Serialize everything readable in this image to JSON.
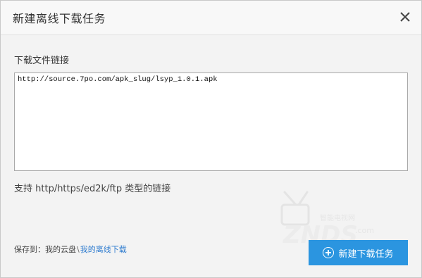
{
  "dialog": {
    "title": "新建离线下载任务",
    "close_icon": "close-icon"
  },
  "form": {
    "url_label": "下载文件链接",
    "url_value": "http://source.7po.com/apk_slug/lsyp_1.0.1.apk",
    "hint": "支持 http/https/ed2k/ftp 类型的链接"
  },
  "save": {
    "label": "保存到：",
    "path_root": "我的云盘",
    "separator": "\\",
    "path_leaf": "我的离线下载"
  },
  "actions": {
    "submit_label": "新建下载任务",
    "submit_icon": "plus-circle-icon"
  },
  "watermark": {
    "brand": "ZNDS",
    "suffix": ".com",
    "tagline": "智能电视网"
  },
  "colors": {
    "accent": "#2b95e0",
    "link": "#2f7ccf",
    "header_bg": "#f8f8f8",
    "body_bg": "#f3f3f3"
  }
}
